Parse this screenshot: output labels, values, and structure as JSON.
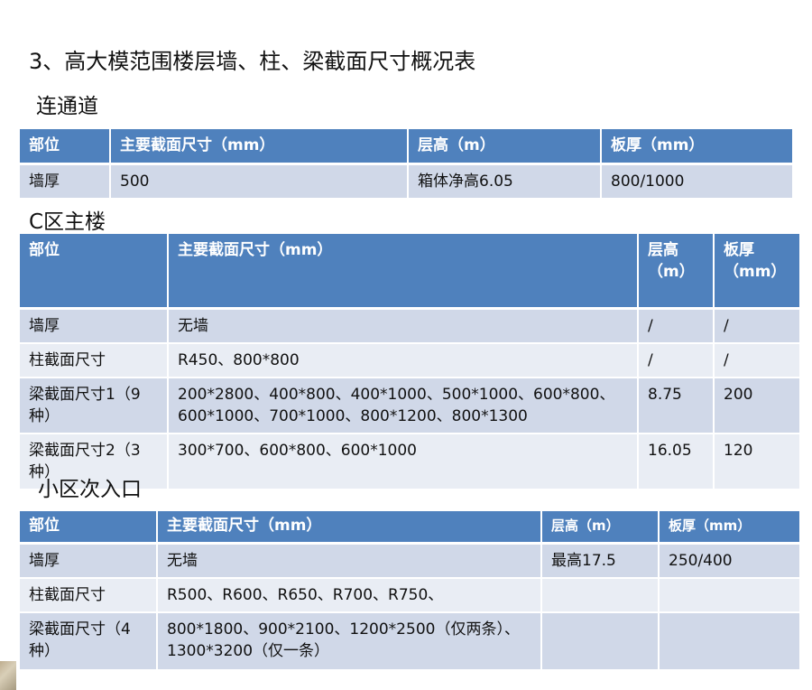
{
  "title": "3、高大模范围楼层墙、柱、梁截面尺寸概况表",
  "sections": [
    {
      "heading": "连通道",
      "headers": [
        "部位",
        "主要截面尺寸（mm）",
        "层高（m）",
        "板厚（mm）"
      ],
      "rows": [
        [
          "墙厚",
          "500",
          "箱体净高6.05",
          "800/1000"
        ]
      ]
    },
    {
      "heading": "C区主楼",
      "headers": [
        "部位",
        "主要截面尺寸（mm）",
        "层高（m）",
        "板厚（mm）"
      ],
      "rows": [
        [
          "墙厚",
          "无墙",
          "/",
          "/"
        ],
        [
          "柱截面尺寸",
          "R450、800*800",
          "/",
          "/"
        ],
        [
          "梁截面尺寸1（9种）",
          "200*2800、400*800、400*1000、500*1000、600*800、600*1000、700*1000、800*1200、800*1300",
          "8.75",
          "200"
        ],
        [
          "梁截面尺寸2（3种）",
          "300*700、600*800、600*1000",
          "16.05",
          "120"
        ]
      ]
    },
    {
      "heading": "小区次入口",
      "headers": [
        "部位",
        "主要截面尺寸（mm）",
        "层高（m）",
        "板厚（mm）"
      ],
      "rows": [
        [
          "墙厚",
          "无墙",
          "最高17.5",
          "250/400"
        ],
        [
          "柱截面尺寸",
          "R500、R600、R650、R700、R750、",
          "",
          ""
        ],
        [
          "梁截面尺寸（4种）",
          "800*1800、900*2100、1200*2500（仅两条）、1300*3200（仅一条）",
          "",
          ""
        ]
      ]
    }
  ]
}
